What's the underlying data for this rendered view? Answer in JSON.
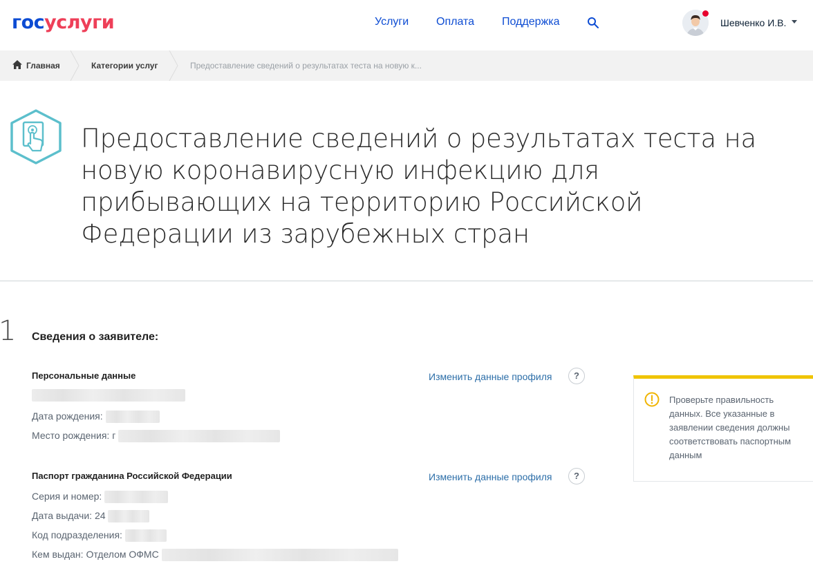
{
  "header": {
    "logo_part1": "гос",
    "logo_part2": "услуги",
    "nav": [
      {
        "label": "Услуги"
      },
      {
        "label": "Оплата"
      },
      {
        "label": "Поддержка"
      }
    ],
    "user_name": "Шевченко И.В."
  },
  "breadcrumbs": [
    {
      "label": "Главная"
    },
    {
      "label": "Категории услуг"
    },
    {
      "label": "Предоставление сведений о результатах теста на новую к..."
    }
  ],
  "page": {
    "title": "Предоставление сведений о результатах теста на новую коронавирусную инфекцию для прибывающих на территорию Российской Федерации из зарубежных стран"
  },
  "step": {
    "number": "1",
    "title": "Сведения о заявителе:"
  },
  "personal": {
    "title": "Персональные данные",
    "edit_label": "Изменить данные профиля",
    "help": "?",
    "birth_date_label": "Дата рождения:",
    "birth_place_label": "Место рождения:",
    "birth_place_prefix": "г"
  },
  "passport": {
    "title": "Паспорт гражданина Российской Федерации",
    "edit_label": "Изменить данные профиля",
    "help": "?",
    "series_label": "Серия и номер:",
    "issue_date_label": "Дата выдачи:",
    "issue_date_prefix": "24",
    "division_label": "Код подразделения:",
    "issued_by_label": "Кем выдан:",
    "issued_by_prefix": "Отделом ОФМС"
  },
  "notice": {
    "text": "Проверьте правильность данных. Все указанные в заявлении сведения должны соответствовать паспортным данным"
  },
  "colors": {
    "brand_blue": "#0d4cd3",
    "brand_red": "#ee3f58",
    "notice_accent": "#f0c400",
    "icon_teal": "#5cbfcc"
  },
  "icons": {
    "search": "search-icon",
    "home": "home-icon",
    "service": "hand-card-icon",
    "notice": "exclamation-circle-icon"
  }
}
